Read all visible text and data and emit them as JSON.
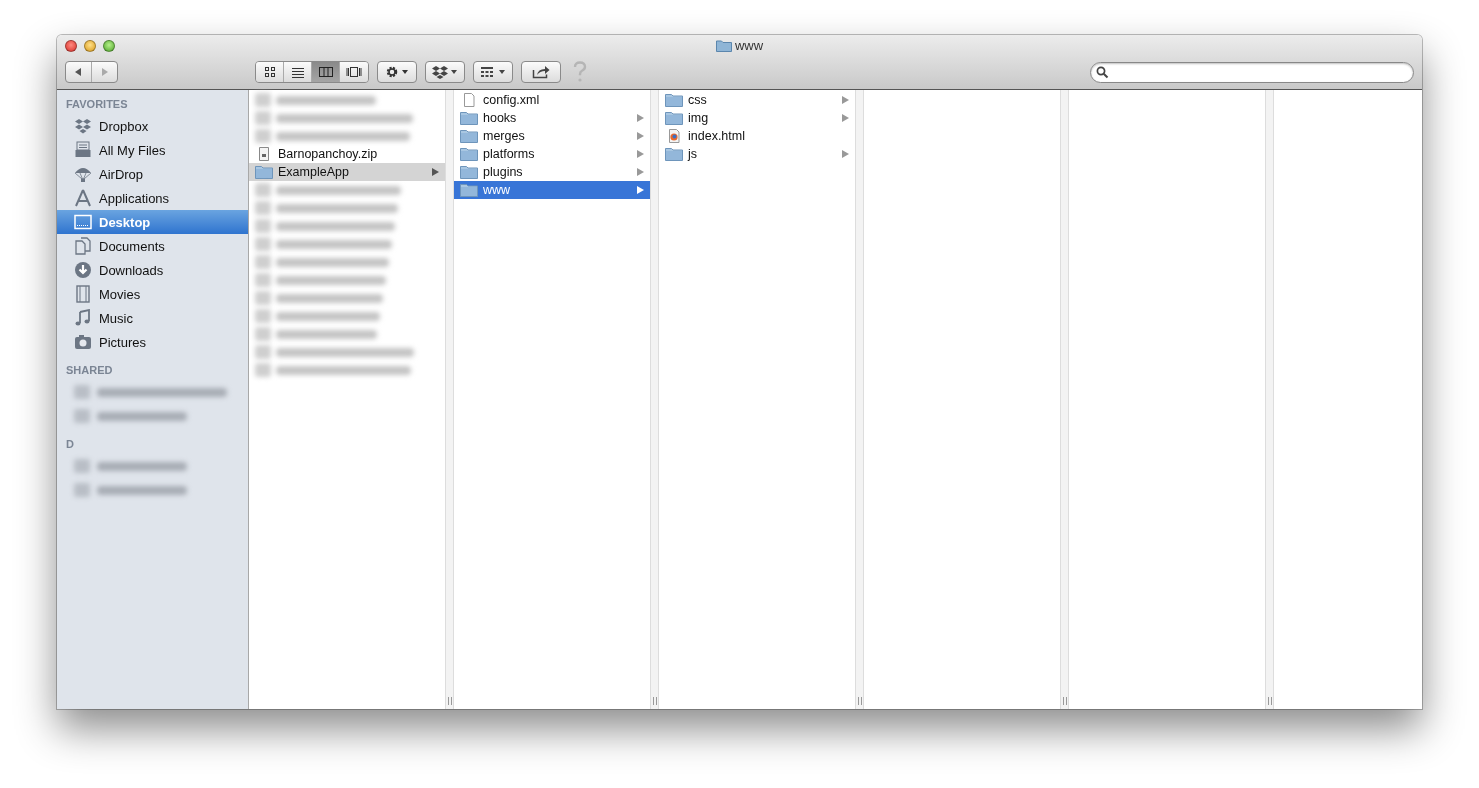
{
  "window": {
    "title": "www"
  },
  "toolbar": {
    "view_modes": [
      {
        "kind": "icons",
        "selected": false
      },
      {
        "kind": "list",
        "selected": false
      },
      {
        "kind": "columns",
        "selected": true
      },
      {
        "kind": "coverflow",
        "selected": false
      }
    ]
  },
  "sidebar": {
    "sections": [
      {
        "heading": "FAVORITES",
        "items": [
          {
            "kind": "dropbox",
            "label": "Dropbox",
            "selected": false
          },
          {
            "kind": "allfiles",
            "label": "All My Files",
            "selected": false
          },
          {
            "kind": "airdrop",
            "label": "AirDrop",
            "selected": false
          },
          {
            "kind": "applications",
            "label": "Applications",
            "selected": false
          },
          {
            "kind": "desktop",
            "label": "Desktop",
            "selected": true
          },
          {
            "kind": "documents",
            "label": "Documents",
            "selected": false
          },
          {
            "kind": "downloads",
            "label": "Downloads",
            "selected": false
          },
          {
            "kind": "movies",
            "label": "Movies",
            "selected": false
          },
          {
            "kind": "music",
            "label": "Music",
            "selected": false
          },
          {
            "kind": "pictures",
            "label": "Pictures",
            "selected": false
          }
        ]
      },
      {
        "heading": "SHARED",
        "items": [
          {
            "kind": "blurred"
          },
          {
            "kind": "blurred"
          }
        ]
      },
      {
        "heading": "D",
        "items": [
          {
            "kind": "blurred"
          },
          {
            "kind": "blurred"
          }
        ]
      }
    ]
  },
  "columns": [
    {
      "items": [
        {
          "kind": "blurred"
        },
        {
          "kind": "blurred"
        },
        {
          "kind": "blurred"
        },
        {
          "kind": "zip",
          "name": "Barnopanchoy.zip",
          "has_children": false,
          "selected": false
        },
        {
          "kind": "folder",
          "name": "ExampleApp",
          "has_children": true,
          "selected": true
        },
        {
          "kind": "blurred"
        },
        {
          "kind": "blurred"
        },
        {
          "kind": "blurred"
        },
        {
          "kind": "blurred"
        },
        {
          "kind": "blurred"
        },
        {
          "kind": "blurred"
        },
        {
          "kind": "blurred"
        },
        {
          "kind": "blurred"
        },
        {
          "kind": "blurred"
        },
        {
          "kind": "blurred"
        },
        {
          "kind": "blurred"
        }
      ]
    },
    {
      "items": [
        {
          "kind": "file",
          "name": "config.xml",
          "has_children": false,
          "selected": false
        },
        {
          "kind": "folder",
          "name": "hooks",
          "has_children": true,
          "selected": false
        },
        {
          "kind": "folder",
          "name": "merges",
          "has_children": true,
          "selected": false
        },
        {
          "kind": "folder",
          "name": "platforms",
          "has_children": true,
          "selected": false
        },
        {
          "kind": "folder",
          "name": "plugins",
          "has_children": true,
          "selected": false
        },
        {
          "kind": "folder",
          "name": "www",
          "has_children": true,
          "selected": true
        }
      ]
    },
    {
      "items": [
        {
          "kind": "folder",
          "name": "css",
          "has_children": true,
          "selected": false
        },
        {
          "kind": "folder",
          "name": "img",
          "has_children": true,
          "selected": false
        },
        {
          "kind": "html",
          "name": "index.html",
          "has_children": false,
          "selected": false
        },
        {
          "kind": "folder",
          "name": "js",
          "has_children": true,
          "selected": false
        }
      ]
    },
    {
      "kind": "empty"
    },
    {
      "kind": "empty"
    },
    {
      "kind": "empty"
    }
  ]
}
